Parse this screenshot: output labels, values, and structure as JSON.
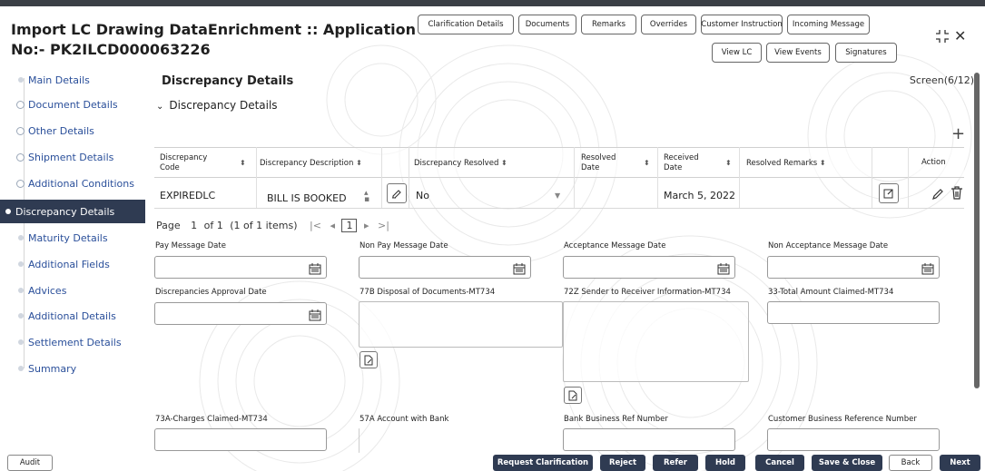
{
  "window": {
    "title_line1": "Import LC Drawing DataEnrichment :: Application",
    "title_line2": "No:- PK2ILCD000063226",
    "close_icon": "close-icon",
    "expand_icon": "collapse-icon"
  },
  "header_buttons": {
    "clarification_details": "Clarification Details",
    "documents": "Documents",
    "remarks": "Remarks",
    "overrides": "Overrides",
    "customer_instruction": "Customer Instruction",
    "incoming_message": "Incoming Message",
    "view_lc": "View LC",
    "view_events": "View Events",
    "signatures": "Signatures"
  },
  "sidebar": {
    "items": [
      {
        "label": "Main Details"
      },
      {
        "label": "Document Details"
      },
      {
        "label": "Other Details"
      },
      {
        "label": "Shipment Details"
      },
      {
        "label": "Additional Conditions"
      },
      {
        "label": "Discrepancy Details"
      },
      {
        "label": "Maturity Details"
      },
      {
        "label": "Additional Fields"
      },
      {
        "label": "Advices"
      },
      {
        "label": "Additional Details"
      },
      {
        "label": "Settlement Details"
      },
      {
        "label": "Summary"
      }
    ]
  },
  "main": {
    "section_title": "Discrepancy Details",
    "screen_indicator": "Screen(6/12)",
    "subsection_title": "Discrepancy Details",
    "table": {
      "headers": {
        "code_1": "Discrepancy",
        "code_2": "Code",
        "description": "Discrepancy Description",
        "resolved": "Discrepancy Resolved",
        "resolved_date_1": "Resolved",
        "resolved_date_2": "Date",
        "received_date_1": "Received",
        "received_date_2": "Date",
        "resolved_remarks": "Resolved Remarks",
        "action": "Action"
      },
      "rows": [
        {
          "code": "EXPIREDLC",
          "description": "BILL IS BOOKED",
          "resolved": "No",
          "resolved_date": "",
          "received_date": "March 5, 2022",
          "resolved_remarks": ""
        }
      ]
    },
    "pagination": {
      "page_label": "Page",
      "current": "1",
      "of_label": "of 1",
      "items": "(1 of 1 items)",
      "page_box": "1"
    },
    "fields": {
      "pay_message_date": {
        "label": "Pay Message Date",
        "value": ""
      },
      "non_pay_message_date": {
        "label": "Non Pay Message Date",
        "value": ""
      },
      "acceptance_message_date": {
        "label": "Acceptance Message Date",
        "value": ""
      },
      "non_acceptance_message_date": {
        "label": "Non Acceptance Message Date",
        "value": ""
      },
      "discrepancies_approval_date": {
        "label": "Discrepancies Approval Date",
        "value": ""
      },
      "disposal_of_documents": {
        "label": "77B Disposal of Documents-MT734",
        "value": ""
      },
      "sender_to_receiver": {
        "label": "72Z Sender to Receiver Information-MT734",
        "value": ""
      },
      "total_amount_claimed": {
        "label": "33-Total Amount Claimed-MT734",
        "value": ""
      },
      "charges_claimed": {
        "label": "73A-Charges Claimed-MT734",
        "value": ""
      },
      "account_with_bank": {
        "label": "57A Account with Bank",
        "value": ""
      },
      "bank_business_ref": {
        "label": "Bank Business Ref Number",
        "value": ""
      },
      "customer_business_ref": {
        "label": "Customer Business Reference Number",
        "value": ""
      }
    }
  },
  "footer": {
    "audit": "Audit",
    "request_clarification": "Request Clarification",
    "reject": "Reject",
    "refer": "Refer",
    "hold": "Hold",
    "cancel": "Cancel",
    "save_close": "Save & Close",
    "back": "Back",
    "next": "Next"
  },
  "colors": {
    "accent_dark": "#2f3b52",
    "link": "#2a4f9a"
  }
}
